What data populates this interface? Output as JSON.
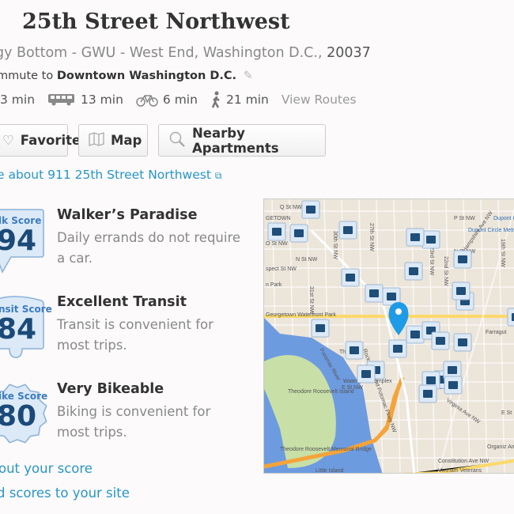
{
  "header": {
    "title": "25th Street Northwest",
    "address_prefix": "gy Bottom - GWU - West End, Washington D.C., ",
    "zip": "20037",
    "commute_prefix": "mmute to ",
    "commute_dest": "Downtown Washington D.C."
  },
  "commute_times": {
    "drive": "3 min",
    "bus": "13 min",
    "bike": "6 min",
    "walk": "21 min",
    "view_routes": "View Routes"
  },
  "buttons": {
    "favorite": "Favorite",
    "map": "Map",
    "nearby": "Nearby Apartments"
  },
  "more_link": "e about 911 25th Street Northwest",
  "scores": [
    {
      "badge_label": "lk Score",
      "value": "94",
      "heading": "Walker’s Paradise",
      "desc": "Daily errands do not require a car."
    },
    {
      "badge_label": "nsit Score",
      "value": "84",
      "heading": "Excellent Transit",
      "desc": "Transit is convenient for most trips."
    },
    {
      "badge_label": "ike Score",
      "value": "80",
      "heading": "Very Bikeable",
      "desc": "Biking is convenient for most trips."
    }
  ],
  "links": {
    "about_score": "out your score",
    "add_scores": "d scores to your site"
  },
  "map": {
    "labels": [
      "Q St NW",
      "GETOWN",
      "O St NW",
      "N St NW",
      "spect St NW",
      "n Park",
      "31st St NW",
      "30th St NW",
      "27th St NW",
      "P St NW",
      "Dupont Cir",
      "Dupont Circle Metro",
      "N St NW",
      "23rd St NW",
      "22nd St NW",
      "New Hampshire Ave NW",
      "19th St NW",
      "Georgetown Waterfront Park",
      "Rock Creek and Potomac Pkwy NW",
      "The Mall",
      "Potomac River",
      "Theodore Roosevelt Island",
      "Watergate Complex",
      "E St NW",
      "F St NW",
      "Virginia Ave NW",
      "Farragut",
      "Theodore Roosevelt Memorial Bridge",
      "Little Island",
      "Constitution Ave NW",
      "Vietnam Veterans",
      "Organiz American",
      "E St"
    ],
    "colors": {
      "land": "#ece5da",
      "water": "#6d9be0",
      "park": "#c8dfa8",
      "highway": "#f4a43a",
      "arterial": "#fbd96b",
      "pin": "#1e9be6",
      "marker": "#1f4e79"
    }
  }
}
